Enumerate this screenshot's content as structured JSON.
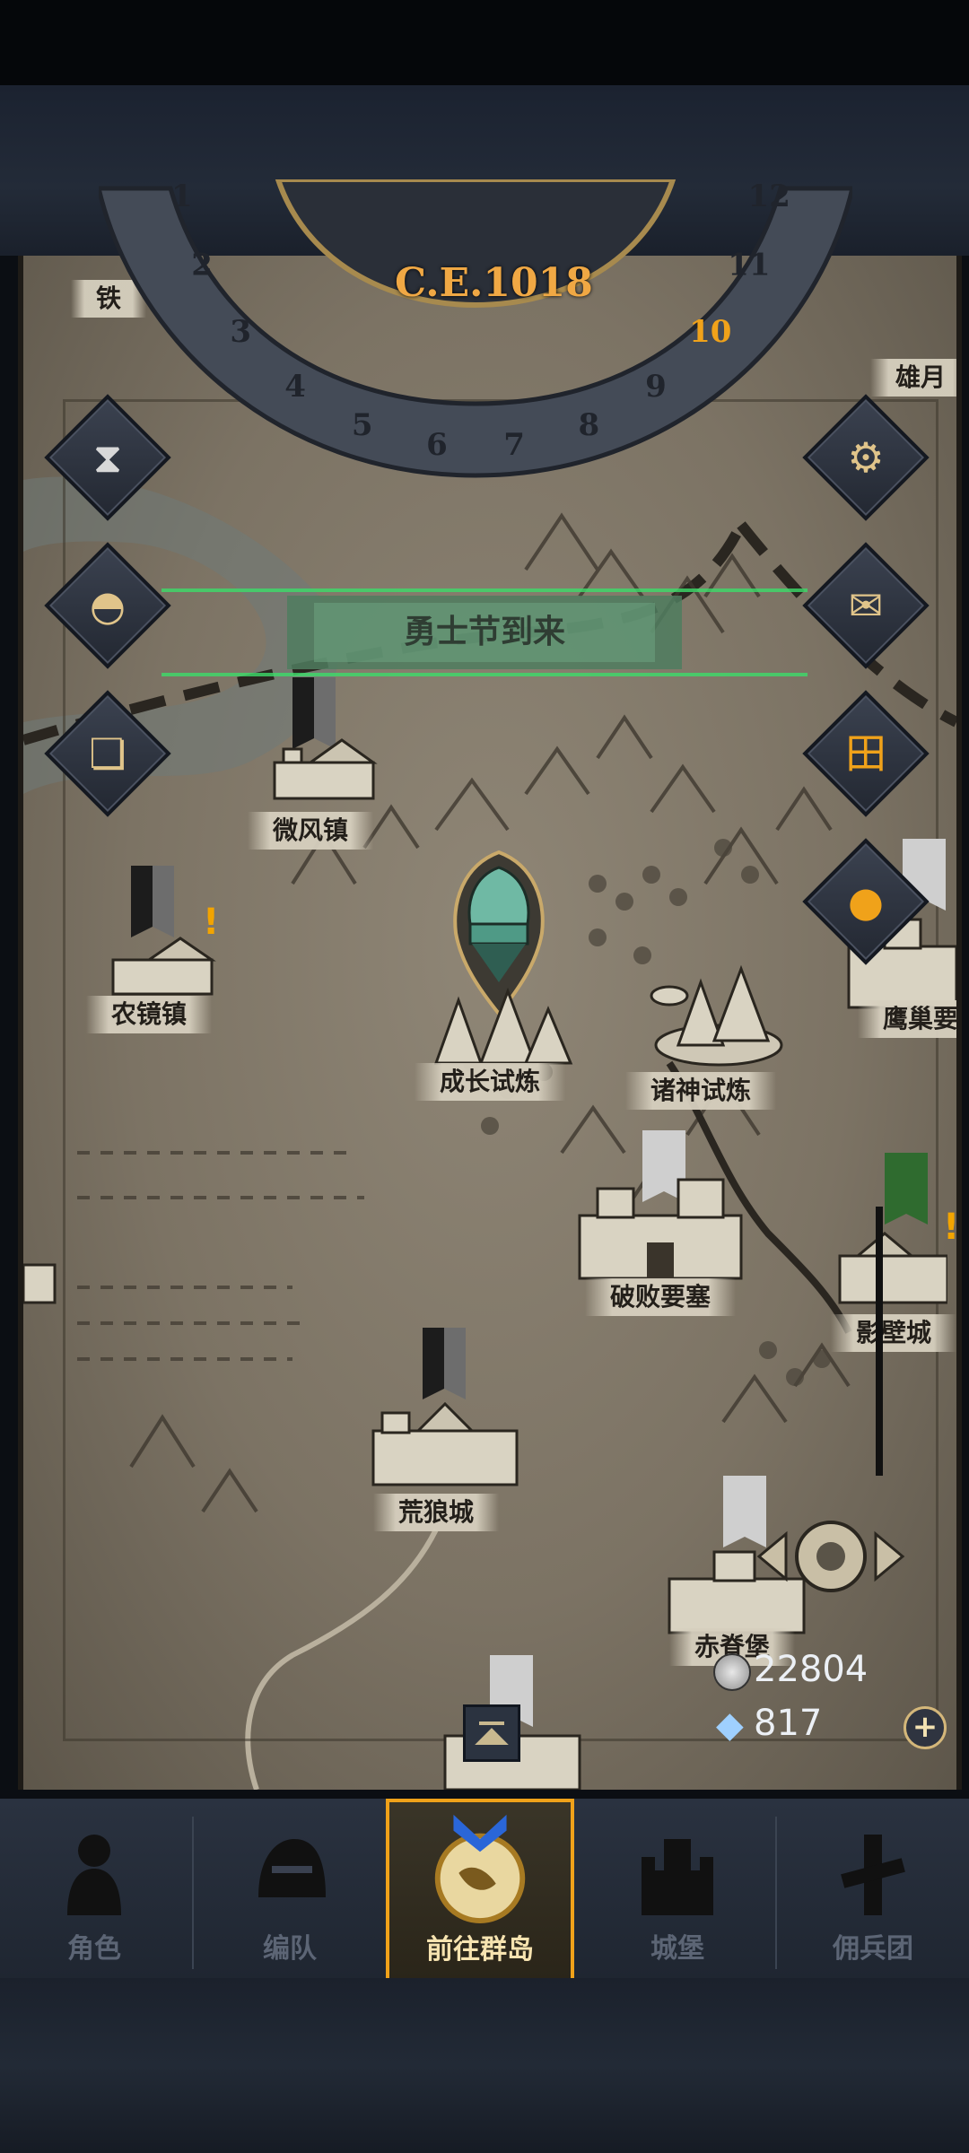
{
  "calendar": {
    "year_label": "C.E.1018",
    "months": [
      "1",
      "2",
      "3",
      "4",
      "5",
      "6",
      "7",
      "8",
      "9",
      "10",
      "11",
      "12"
    ],
    "current_month": "10"
  },
  "event_banner": {
    "text": "勇士节到来"
  },
  "map_labels": {
    "top_left_partial": "铁",
    "top_right_partial": "雄月",
    "weifeng": "微风镇",
    "nongjing": "农镜镇",
    "yingchao": "鹰巢要",
    "chengzhang": "成长试炼",
    "zhushen": "诸神试炼",
    "pobai": "破败要塞",
    "yingbi": "影壁城",
    "huanglang": "荒狼城",
    "chiji": "赤脊堡"
  },
  "resources": {
    "silver": "22804",
    "crystal": "817"
  },
  "tabs": [
    {
      "label": "角色",
      "icon": "knight-icon"
    },
    {
      "label": "编队",
      "icon": "helmet-icon"
    },
    {
      "label": "前往群岛",
      "icon": "compass-map-icon",
      "active": true
    },
    {
      "label": "城堡",
      "icon": "castle-icon"
    },
    {
      "label": "佣兵团",
      "icon": "mercenary-icon"
    }
  ],
  "colors": {
    "accent": "#f0a21a",
    "event_green": "#3ddc6a",
    "parchment": "#8a8171"
  }
}
